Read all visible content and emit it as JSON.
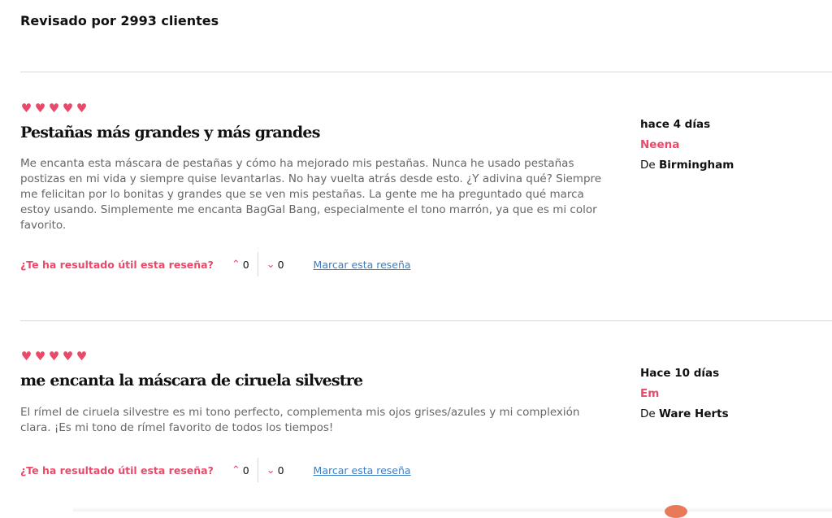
{
  "summary": "Revisado por 2993 clientes",
  "colors": {
    "accent": "#e94a6a",
    "link": "#3a7ec6"
  },
  "reviews": [
    {
      "rating": 5,
      "title": "Pestañas más grandes y más grandes",
      "body": "Me encanta esta máscara de pestañas y cómo ha mejorado mis pestañas. Nunca he usado pestañas postizas en mi vida y siempre quise levantarlas. No hay vuelta atrás desde esto. ¿Y adivina qué? Siempre me felicitan por lo bonitas y grandes que se ven mis pestañas. La gente me ha preguntado qué marca estoy usando. Simplemente me encanta BagGal Bang, especialmente el tono marrón, ya que es mi color favorito.",
      "date": "hace 4 días",
      "author": "Neena",
      "location_prefix": "De",
      "location": "Birmingham",
      "helpful_question": "¿Te ha resultado útil esta reseña?",
      "upvotes": "0",
      "downvotes": "0",
      "flag_label": "Marcar esta reseña"
    },
    {
      "rating": 5,
      "title": "me encanta la máscara de ciruela silvestre",
      "body": "El rímel de ciruela silvestre es mi tono perfecto, complementa mis ojos grises/azules y mi complexión clara. ¡Es mi tono de rímel favorito de todos los tiempos!",
      "date": "Hace 10 días",
      "author": "Em",
      "location_prefix": "De",
      "location": "Ware Herts",
      "helpful_question": "¿Te ha resultado útil esta reseña?",
      "upvotes": "0",
      "downvotes": "0",
      "flag_label": "Marcar esta reseña"
    }
  ]
}
